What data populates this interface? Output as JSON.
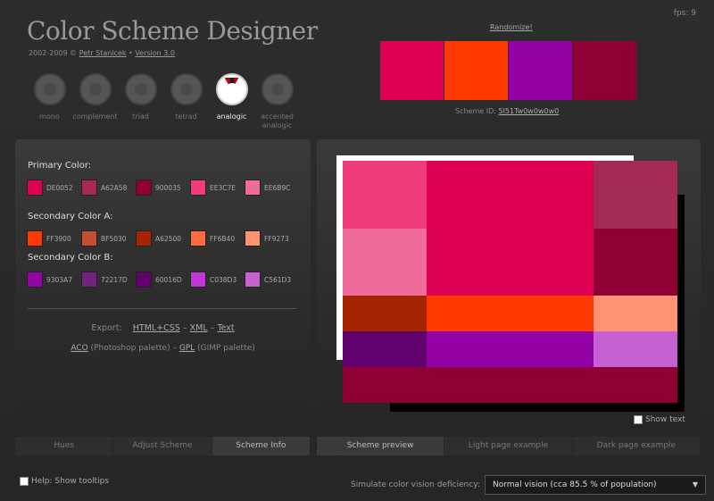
{
  "fps": "fps: 9",
  "logo": "Color Scheme Designer",
  "credits": {
    "years": "2002-2009 © ",
    "author": "Petr Stanicek",
    "sep": " • ",
    "version": "Version 3.0"
  },
  "modes": [
    {
      "label": "mono",
      "active": false
    },
    {
      "label": "complement",
      "active": false
    },
    {
      "label": "triad",
      "active": false
    },
    {
      "label": "tetrad",
      "active": false
    },
    {
      "label": "analogic",
      "active": true
    },
    {
      "label": "accented analogic",
      "active": false
    }
  ],
  "randomize": "Randomize!",
  "top_swatches": [
    "#DE0052",
    "#FF3900",
    "#9303A7",
    "#900035"
  ],
  "scheme_id": {
    "label": "Scheme ID: ",
    "value": "5I51Tw0w0w0w0"
  },
  "groups": [
    {
      "title": "Primary Color:",
      "colors": [
        "DE0052",
        "A62A58",
        "900035",
        "EE3C7E",
        "EE6B9C"
      ]
    },
    {
      "title": "Secondary Color A:",
      "colors": [
        "FF3900",
        "BF5030",
        "A62500",
        "FF6B40",
        "FF9273"
      ]
    },
    {
      "title": "Secondary Color B:",
      "colors": [
        "9303A7",
        "72217D",
        "60016D",
        "C038D3",
        "C561D3"
      ]
    }
  ],
  "export": {
    "label": "Export:",
    "html": "HTML+CSS",
    "dash1": " – ",
    "xml": "XML",
    "dash2": " – ",
    "text": "Text",
    "aco": "ACO",
    "aco_desc": " (Photoshop palette) – ",
    "gpl": "GPL",
    "gpl_desc": " (GIMP palette)"
  },
  "left_tabs": [
    {
      "label": "Hues",
      "active": false
    },
    {
      "label": "Adjust Scheme",
      "active": false
    },
    {
      "label": "Scheme Info",
      "active": true
    }
  ],
  "right_tabs": [
    {
      "label": "Scheme preview",
      "active": true
    },
    {
      "label": "Light page example",
      "active": false
    },
    {
      "label": "Dark page example",
      "active": false
    }
  ],
  "show_text": "Show text",
  "help": "Help: Show tooltips",
  "cvd_label": "Simulate color vision deficiency:",
  "cvd_value": "Normal vision (cca 85.5 % of population)"
}
